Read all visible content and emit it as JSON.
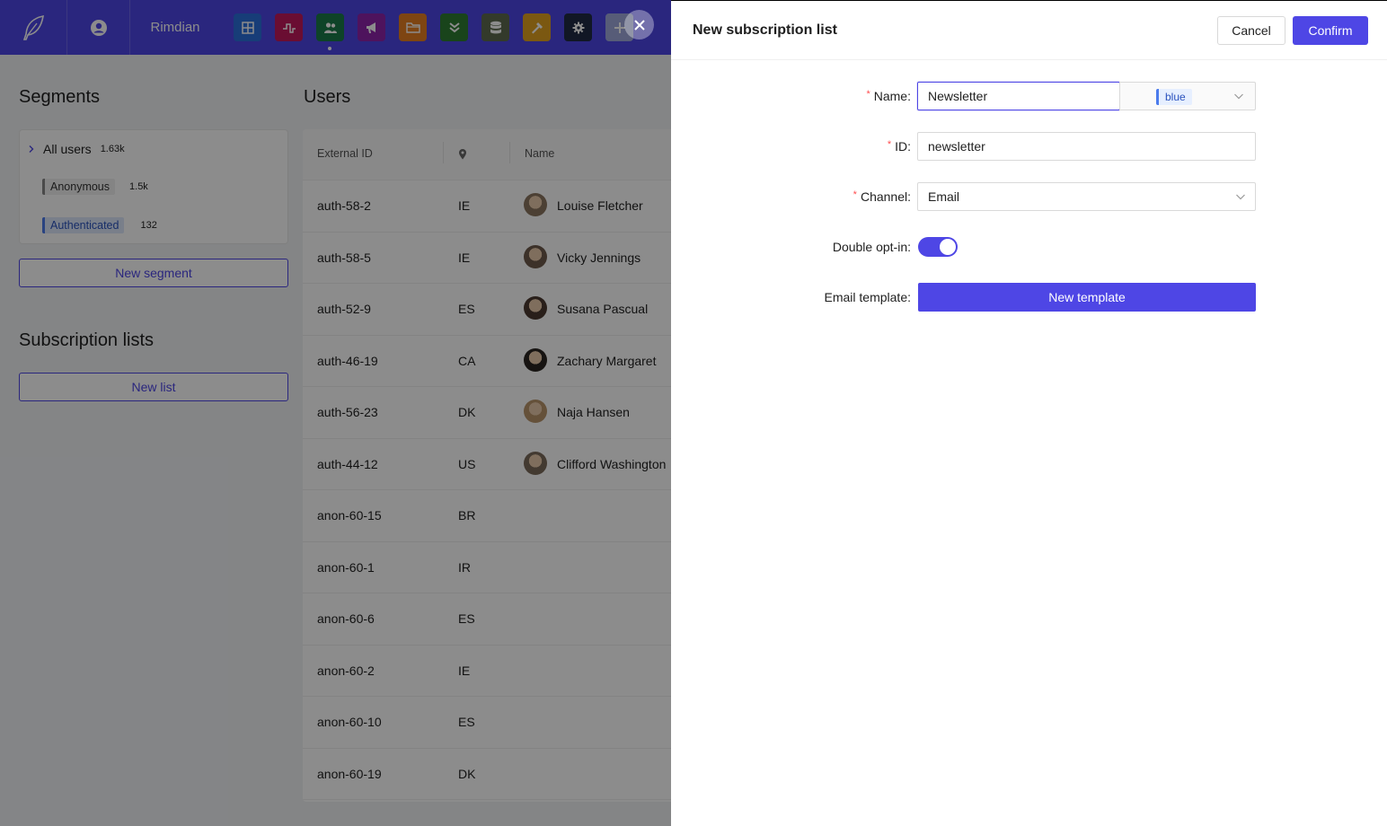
{
  "topbar": {
    "workspace_name": "Rimdian",
    "apps": [
      {
        "icon": "dashboard-icon",
        "color": "#2a6fdb"
      },
      {
        "icon": "analytics-icon",
        "color": "#c2185b"
      },
      {
        "icon": "users-icon",
        "color": "#1b7a4a"
      },
      {
        "icon": "megaphone-icon",
        "color": "#8e24aa"
      },
      {
        "icon": "folder-icon",
        "color": "#e67e22"
      },
      {
        "icon": "chevrons-down-icon",
        "color": "#2e7d32"
      },
      {
        "icon": "database-icon",
        "color": "#5d6b4f"
      },
      {
        "icon": "hammer-icon",
        "color": "#e0a020"
      },
      {
        "icon": "gear-icon",
        "color": "#1f2a44"
      },
      {
        "icon": "plus-icon",
        "color": "#9fa8da"
      }
    ]
  },
  "segments": {
    "title": "Segments",
    "all_users": {
      "label": "All users",
      "count": "1.63k"
    },
    "items": [
      {
        "label": "Anonymous",
        "count": "1.5k"
      },
      {
        "label": "Authenticated",
        "count": "132"
      }
    ],
    "new_segment_label": "New segment"
  },
  "subscription_lists": {
    "title": "Subscription lists",
    "new_list_label": "New list"
  },
  "users": {
    "title": "Users",
    "columns": [
      "External ID",
      "Name"
    ],
    "rows": [
      {
        "external_id": "auth-58-2",
        "country": "IE",
        "name": "Louise Fletcher"
      },
      {
        "external_id": "auth-58-5",
        "country": "IE",
        "name": "Vicky Jennings"
      },
      {
        "external_id": "auth-52-9",
        "country": "ES",
        "name": "Susana Pascual"
      },
      {
        "external_id": "auth-46-19",
        "country": "CA",
        "name": "Zachary Margaret"
      },
      {
        "external_id": "auth-56-23",
        "country": "DK",
        "name": "Naja Hansen"
      },
      {
        "external_id": "auth-44-12",
        "country": "US",
        "name": "Clifford Washington"
      },
      {
        "external_id": "anon-60-15",
        "country": "BR",
        "name": ""
      },
      {
        "external_id": "anon-60-1",
        "country": "IR",
        "name": ""
      },
      {
        "external_id": "anon-60-6",
        "country": "ES",
        "name": ""
      },
      {
        "external_id": "anon-60-2",
        "country": "IE",
        "name": ""
      },
      {
        "external_id": "anon-60-10",
        "country": "ES",
        "name": ""
      },
      {
        "external_id": "anon-60-19",
        "country": "DK",
        "name": ""
      }
    ]
  },
  "drawer": {
    "title": "New subscription list",
    "cancel_label": "Cancel",
    "confirm_label": "Confirm",
    "fields": {
      "name": {
        "label": "Name",
        "value": "Newsletter",
        "color": "blue"
      },
      "id": {
        "label": "ID",
        "value": "newsletter"
      },
      "channel": {
        "label": "Channel",
        "value": "Email"
      },
      "double_opt_in": {
        "label": "Double opt-in",
        "checked": true
      },
      "email_template": {
        "label": "Email template",
        "button_label": "New template"
      }
    }
  },
  "colors": {
    "accent": "#4e46e5",
    "required": "#ff4d4f"
  }
}
